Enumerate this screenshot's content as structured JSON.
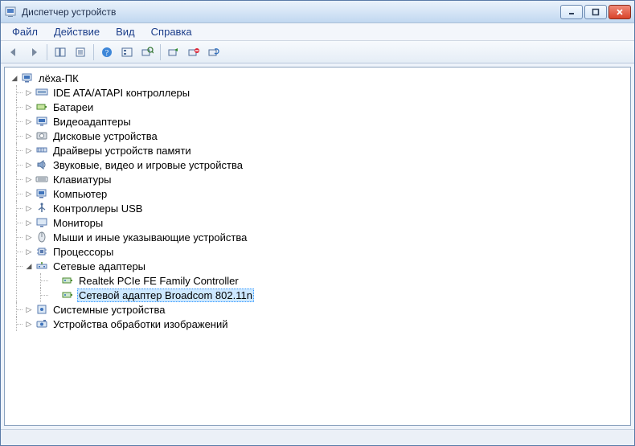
{
  "window": {
    "title": "Диспетчер устройств"
  },
  "menu": {
    "file": "Файл",
    "action": "Действие",
    "view": "Вид",
    "help": "Справка"
  },
  "tree": {
    "root": "лёха-ПК",
    "categories": [
      {
        "icon": "ide",
        "label": "IDE ATA/ATAPI контроллеры"
      },
      {
        "icon": "battery",
        "label": "Батареи"
      },
      {
        "icon": "display",
        "label": "Видеоадаптеры"
      },
      {
        "icon": "disk",
        "label": "Дисковые устройства"
      },
      {
        "icon": "memory",
        "label": "Драйверы устройств памяти"
      },
      {
        "icon": "sound",
        "label": "Звуковые, видео и игровые устройства"
      },
      {
        "icon": "keyboard",
        "label": "Клавиатуры"
      },
      {
        "icon": "computer",
        "label": "Компьютер"
      },
      {
        "icon": "usb",
        "label": "Контроллеры USB"
      },
      {
        "icon": "monitor",
        "label": "Мониторы"
      },
      {
        "icon": "mouse",
        "label": "Мыши и иные указывающие устройства"
      },
      {
        "icon": "cpu",
        "label": "Процессоры"
      },
      {
        "icon": "network",
        "label": "Сетевые адаптеры",
        "expanded": true,
        "children": [
          {
            "icon": "nic",
            "label": "Realtek PCIe FE Family Controller"
          },
          {
            "icon": "nic",
            "label": "Сетевой адаптер Broadcom 802.11n",
            "selected": true
          }
        ]
      },
      {
        "icon": "system",
        "label": "Системные устройства"
      },
      {
        "icon": "imaging",
        "label": "Устройства обработки изображений"
      }
    ]
  }
}
